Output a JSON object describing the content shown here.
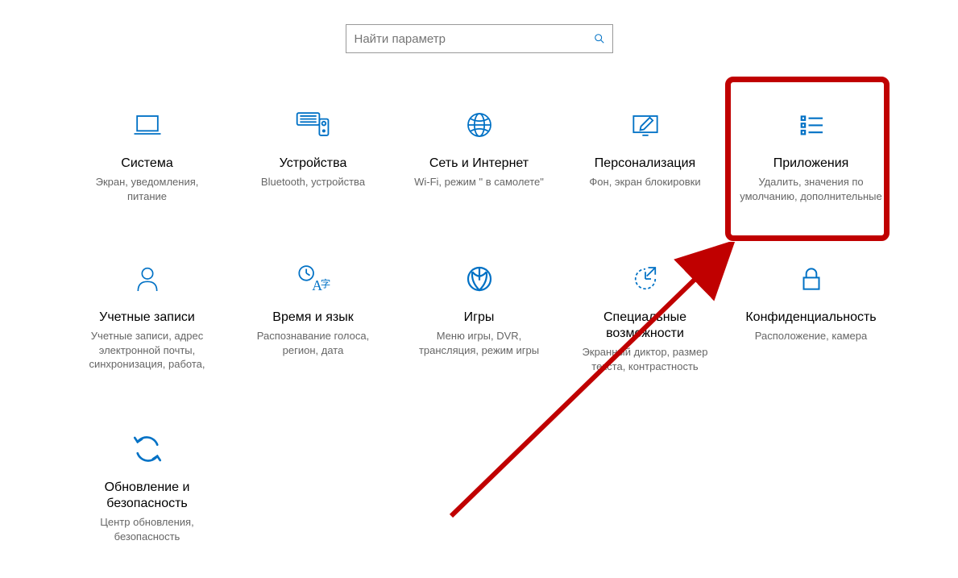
{
  "search": {
    "placeholder": "Найти параметр"
  },
  "accent": "#0071C5",
  "tiles": [
    {
      "icon": "laptop",
      "title": "Система",
      "desc": "Экран, уведомления, питание"
    },
    {
      "icon": "devices",
      "title": "Устройства",
      "desc": "Bluetooth, устройства"
    },
    {
      "icon": "globe",
      "title": "Сеть и Интернет",
      "desc": "Wi-Fi, режим \" в самолете\""
    },
    {
      "icon": "personal",
      "title": "Персонализация",
      "desc": "Фон, экран блокировки"
    },
    {
      "icon": "apps",
      "title": "Приложения",
      "desc": "Удалить, значения по умолчанию, дополнительные"
    },
    {
      "icon": "person",
      "title": "Учетные записи",
      "desc": "Учетные записи, адрес электронной почты, синхронизация, работа,"
    },
    {
      "icon": "timelang",
      "title": "Время и язык",
      "desc": "Распознавание голоса, регион, дата"
    },
    {
      "icon": "gaming",
      "title": "Игры",
      "desc": "Меню игры, DVR, трансляция, режим игры"
    },
    {
      "icon": "ease",
      "title": "Специальные возможности",
      "desc": "Экранный диктор, размер текста, контрастность"
    },
    {
      "icon": "lock",
      "title": "Конфиденциальность",
      "desc": "Расположение, камера"
    },
    {
      "icon": "update",
      "title": "Обновление и безопасность",
      "desc": "Центр обновления, безопасность"
    }
  ]
}
